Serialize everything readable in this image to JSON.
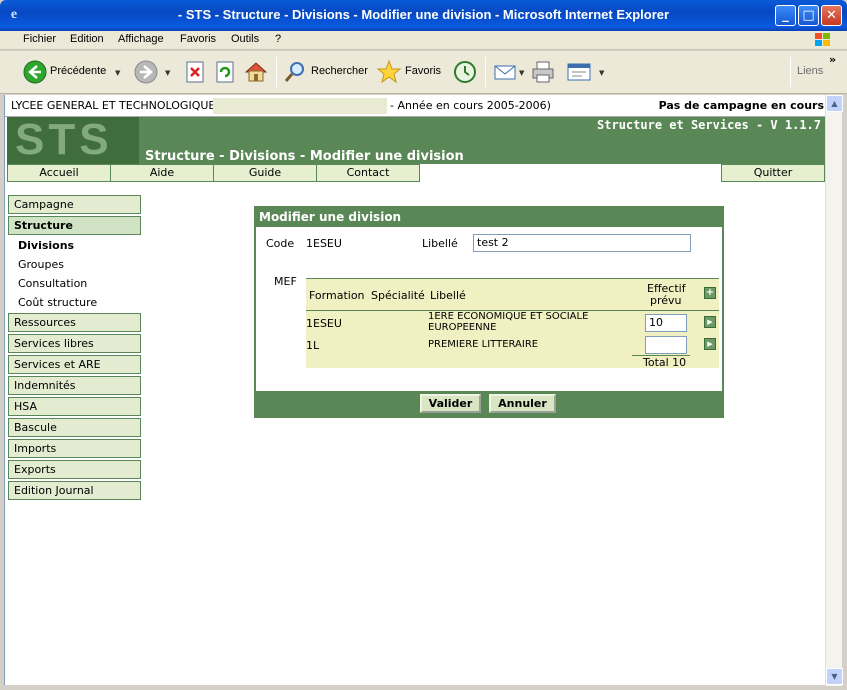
{
  "window": {
    "title": "- STS - Structure - Divisions - Modifier une division - Microsoft Internet Explorer"
  },
  "menubar": {
    "items": [
      "Fichier",
      "Edition",
      "Affichage",
      "Favoris",
      "Outils",
      "?"
    ]
  },
  "toolbar": {
    "back_label": "Précédente",
    "search_label": "Rechercher",
    "favorites_label": "Favoris",
    "links_label": "Liens"
  },
  "infobar": {
    "school": "LYCEE GENERAL ET TECHNOLOGIQUE",
    "year": "- Année en cours 2005-2006)",
    "campaign": "Pas de campagne en cours"
  },
  "banner": {
    "logo": "STS",
    "title": "Structure - Divisions - Modifier une division",
    "version": "Structure et Services - V 1.1.7"
  },
  "nav": {
    "tabs": [
      "Accueil",
      "Aide",
      "Guide",
      "Contact"
    ],
    "quit": "Quitter"
  },
  "sidebar": {
    "campagne": "Campagne",
    "structure": "Structure",
    "sub": [
      "Divisions",
      "Groupes",
      "Consultation",
      "Coût structure"
    ],
    "items": [
      "Ressources",
      "Services libres",
      "Services et ARE",
      "Indemnités",
      "HSA",
      "Bascule",
      "Imports",
      "Exports",
      "Edition Journal"
    ]
  },
  "form": {
    "header": "Modifier une division",
    "code_label": "Code",
    "code_value": "1ESEU",
    "libelle_label": "Libellé",
    "libelle_value": "test 2",
    "mef_label": "MEF",
    "columns": {
      "formation": "Formation",
      "specialite": "Spécialité",
      "libelle": "Libellé",
      "effectif_1": "Effectif",
      "effectif_2": "prévu"
    },
    "rows": [
      {
        "formation": "1ESEU",
        "libelle_1": "1ERE ECONOMIQUE ET SOCIALE",
        "libelle_2": "EUROPEENNE",
        "effectif": "10"
      },
      {
        "formation": "1L",
        "libelle_1": "PREMIERE LITTERAIRE",
        "libelle_2": "",
        "effectif": ""
      }
    ],
    "total_label": "Total 10",
    "validate": "Valider",
    "cancel": "Annuler"
  }
}
